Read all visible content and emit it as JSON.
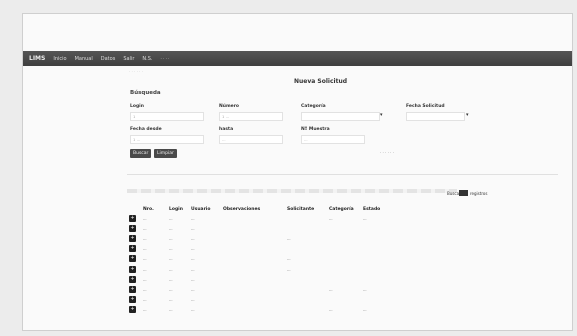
{
  "navbar": {
    "brand": "LIMS",
    "items": [
      "Inicio",
      "Manual",
      "Datos",
      "Salir",
      "N.S."
    ],
    "faint_text": "· · · ·"
  },
  "breadcrumb": "· · · · · ·",
  "section_title": "Nueva Solicitud",
  "panel_title": "Búsqueda",
  "form": {
    "row1": [
      {
        "label": "Login",
        "value": "1"
      },
      {
        "label": "Número",
        "value": "1 ..."
      },
      {
        "label": "Categoría",
        "value": ""
      },
      {
        "label": "Fecha Solicitud",
        "value": ""
      }
    ],
    "row2": [
      {
        "label": "Fecha desde",
        "value": "1 ..."
      },
      {
        "label": "hasta",
        "value": "..."
      },
      {
        "label": "Nº Muestra",
        "value": "..."
      }
    ],
    "dropdown_arrows": [
      "▾",
      "▾"
    ]
  },
  "buttons": {
    "search": "Buscar",
    "clear": "Limpiar"
  },
  "right_note": "· · · · · ·",
  "search": {
    "label": "Buscar",
    "after": "registros"
  },
  "table": {
    "headers": [
      "Nro.",
      "Login",
      "Usuario",
      "Observaciones",
      "Solicitante",
      "Categoría",
      "Estado"
    ],
    "rows": [
      [
        "...",
        "...",
        "...",
        "",
        "",
        "...",
        "..."
      ],
      [
        "...",
        "...",
        "...",
        "",
        "",
        "",
        ""
      ],
      [
        "...",
        "...",
        "...",
        "",
        "...",
        "",
        ""
      ],
      [
        "...",
        "...",
        "...",
        "",
        "",
        "",
        ""
      ],
      [
        "...",
        "...",
        "...",
        "",
        "...",
        "",
        ""
      ],
      [
        "...",
        "...",
        "...",
        "",
        "...",
        "",
        ""
      ],
      [
        "...",
        "...",
        "...",
        "",
        "",
        "",
        ""
      ],
      [
        "...",
        "...",
        "...",
        "",
        "",
        "...",
        "..."
      ],
      [
        "...",
        "...",
        "...",
        "",
        "",
        "",
        ""
      ],
      [
        "...",
        "...",
        "...",
        "",
        "",
        "...",
        "..."
      ]
    ]
  },
  "row_icon": "plus-icon"
}
